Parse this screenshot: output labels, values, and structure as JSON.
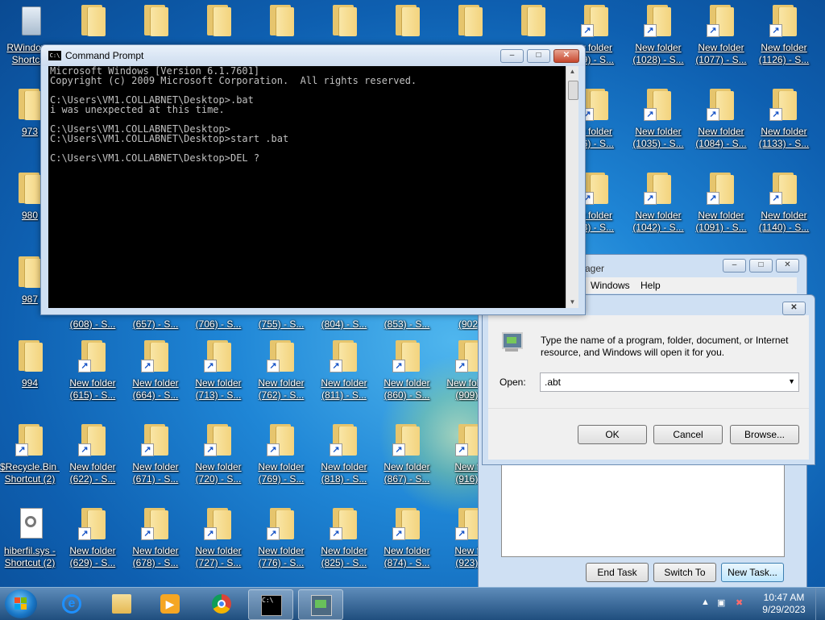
{
  "desktop": {
    "icons": [
      {
        "label": "RWindows",
        "line2": "Shortcut",
        "type": "bin"
      },
      {
        "label": "",
        "line2": "",
        "type": "folder"
      },
      {
        "label": "",
        "line2": "",
        "type": "folder"
      },
      {
        "label": "",
        "line2": "",
        "type": "folder"
      },
      {
        "label": "",
        "line2": "",
        "type": "folder"
      },
      {
        "label": "",
        "line2": "",
        "type": "folder"
      },
      {
        "label": "",
        "line2": "",
        "type": "folder"
      },
      {
        "label": "",
        "line2": "",
        "type": "folder"
      },
      {
        "label": "",
        "line2": "",
        "type": "folder"
      },
      {
        "label": "w folder",
        "line2": "79) - S...",
        "type": "folder"
      },
      {
        "label": "New folder",
        "line2": "(1028) - S...",
        "type": "folder"
      },
      {
        "label": "New folder",
        "line2": "(1077) - S...",
        "type": "folder"
      },
      {
        "label": "New folder",
        "line2": "(1126) - S...",
        "type": "folder"
      },
      {
        "label": "973",
        "line2": "",
        "type": "folder"
      },
      {
        "label": "w folder",
        "line2": "86) - S...",
        "type": "folder"
      },
      {
        "label": "New folder",
        "line2": "(1035) - S...",
        "type": "folder"
      },
      {
        "label": "New folder",
        "line2": "(1084) - S...",
        "type": "folder"
      },
      {
        "label": "New folder",
        "line2": "(1133) - S...",
        "type": "folder"
      },
      {
        "label": "980",
        "line2": "",
        "type": "folder"
      },
      {
        "label": "w folder",
        "line2": "93) - S...",
        "type": "folder"
      },
      {
        "label": "New folder",
        "line2": "(1042) - S...",
        "type": "folder"
      },
      {
        "label": "New folder",
        "line2": "(1091) - S...",
        "type": "folder"
      },
      {
        "label": "New folder",
        "line2": "(1140) - S...",
        "type": "folder"
      },
      {
        "label": "987",
        "line2": "",
        "type": "folder"
      },
      {
        "label": "",
        "line2": "(608) - S...",
        "type": "partial"
      },
      {
        "label": "",
        "line2": "(657) - S...",
        "type": "partial"
      },
      {
        "label": "",
        "line2": "(706) - S...",
        "type": "partial"
      },
      {
        "label": "",
        "line2": "(755) - S...",
        "type": "partial"
      },
      {
        "label": "",
        "line2": "(804) - S...",
        "type": "partial"
      },
      {
        "label": "",
        "line2": "(853) - S...",
        "type": "partial"
      },
      {
        "label": "",
        "line2": "(902)",
        "type": "partial"
      },
      {
        "label": "994",
        "line2": "",
        "type": "folder"
      },
      {
        "label": "New folder",
        "line2": "(615) - S...",
        "type": "folder"
      },
      {
        "label": "New folder",
        "line2": "(664) - S...",
        "type": "folder"
      },
      {
        "label": "New folder",
        "line2": "(713) - S...",
        "type": "folder"
      },
      {
        "label": "New folder",
        "line2": "(762) - S...",
        "type": "folder"
      },
      {
        "label": "New folder",
        "line2": "(811) - S...",
        "type": "folder"
      },
      {
        "label": "New folder",
        "line2": "(860) - S...",
        "type": "folder"
      },
      {
        "label": "New folder",
        "line2": "(909) -",
        "type": "folder"
      },
      {
        "label": "$Recycle.Bin -",
        "line2": "Shortcut (2)",
        "type": "folder"
      },
      {
        "label": "New folder",
        "line2": "(622) - S...",
        "type": "folder"
      },
      {
        "label": "New folder",
        "line2": "(671) - S...",
        "type": "folder"
      },
      {
        "label": "New folder",
        "line2": "(720) - S...",
        "type": "folder"
      },
      {
        "label": "New folder",
        "line2": "(769) - S...",
        "type": "folder"
      },
      {
        "label": "New folder",
        "line2": "(818) - S...",
        "type": "folder"
      },
      {
        "label": "New folder",
        "line2": "(867) - S...",
        "type": "folder"
      },
      {
        "label": "New fo",
        "line2": "(916) -",
        "type": "folder"
      },
      {
        "label": "hiberfil.sys -",
        "line2": "Shortcut (2)",
        "type": "sys"
      },
      {
        "label": "New folder",
        "line2": "(629) - S...",
        "type": "folder"
      },
      {
        "label": "New folder",
        "line2": "(678) - S...",
        "type": "folder"
      },
      {
        "label": "New folder",
        "line2": "(727) - S...",
        "type": "folder"
      },
      {
        "label": "New folder",
        "line2": "(776) - S...",
        "type": "folder"
      },
      {
        "label": "New folder",
        "line2": "(825) - S...",
        "type": "folder"
      },
      {
        "label": "New folder",
        "line2": "(874) - S...",
        "type": "folder"
      },
      {
        "label": "New fo",
        "line2": "(923) -",
        "type": "folder"
      }
    ]
  },
  "cmd": {
    "title": "Command Prompt",
    "lines": [
      "Microsoft Windows [Version 6.1.7601]",
      "Copyright (c) 2009 Microsoft Corporation.  All rights reserved.",
      "",
      "C:\\Users\\VM1.COLLABNET\\Desktop>.bat",
      "i was unexpected at this time.",
      "",
      "C:\\Users\\VM1.COLLABNET\\Desktop>",
      "C:\\Users\\VM1.COLLABNET\\Desktop>start .bat",
      "",
      "C:\\Users\\VM1.COLLABNET\\Desktop>DEL ?"
    ]
  },
  "taskmgr": {
    "title_partial": "ager",
    "menu": [
      "Windows",
      "Help"
    ],
    "buttons": {
      "end_task": "End Task",
      "switch_to": "Switch To",
      "new_task": "New Task..."
    }
  },
  "run": {
    "message": "Type the name of a program, folder, document, or Internet resource, and Windows will open it for you.",
    "open_label": "Open:",
    "open_value": ".abt",
    "ok": "OK",
    "cancel": "Cancel",
    "browse": "Browse..."
  },
  "taskbar": {
    "time": "10:47 AM",
    "date": "9/29/2023"
  }
}
